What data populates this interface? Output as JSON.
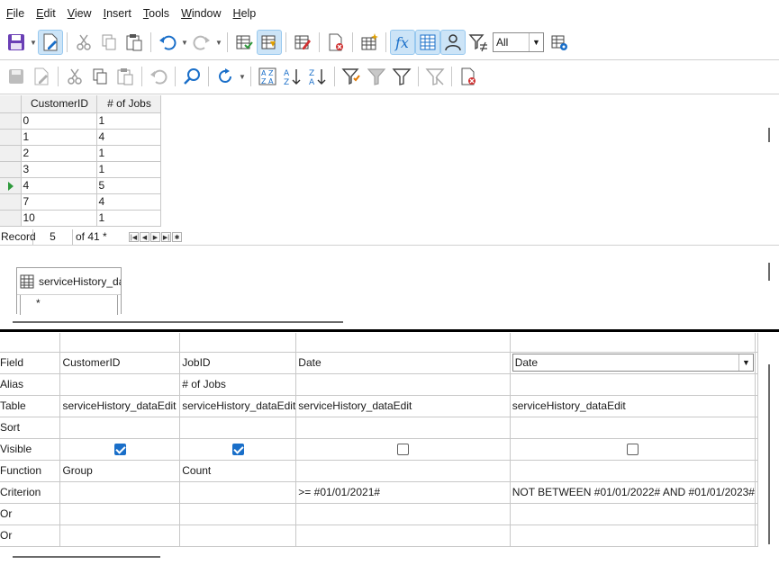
{
  "menu": [
    "File",
    "Edit",
    "View",
    "Insert",
    "Tools",
    "Window",
    "Help"
  ],
  "menu_mnemonics": [
    "F",
    "E",
    "V",
    "I",
    "T",
    "W",
    "H"
  ],
  "filter_select": {
    "value": "All"
  },
  "result": {
    "columns": [
      "CustomerID",
      "# of Jobs"
    ],
    "rows": [
      [
        "0",
        "1"
      ],
      [
        "1",
        "4"
      ],
      [
        "2",
        "1"
      ],
      [
        "3",
        "1"
      ],
      [
        "4",
        "5"
      ],
      [
        "7",
        "4"
      ],
      [
        "10",
        "1"
      ]
    ],
    "current_row_index": 4
  },
  "navigation": {
    "label": "Record",
    "current": "5",
    "of_text": "of 41 *"
  },
  "table_window": {
    "title": "serviceHistory_dataEdit",
    "field": "*"
  },
  "design": {
    "row_labels": [
      "Field",
      "Alias",
      "Table",
      "Sort",
      "Visible",
      "Function",
      "Criterion",
      "Or",
      "Or"
    ],
    "columns": [
      {
        "field": "CustomerID",
        "alias": "",
        "table": "serviceHistory_dataEdit",
        "sort": "",
        "visible": true,
        "function": "Group",
        "criterion": "",
        "or1": "",
        "or2": ""
      },
      {
        "field": "JobID",
        "alias": "# of Jobs",
        "table": "serviceHistory_dataEdit",
        "sort": "",
        "visible": true,
        "function": "Count",
        "criterion": "",
        "or1": "",
        "or2": ""
      },
      {
        "field": "Date",
        "alias": "",
        "table": "serviceHistory_dataEdit",
        "sort": "",
        "visible": false,
        "function": "",
        "criterion": ">= #01/01/2021#",
        "or1": "",
        "or2": ""
      },
      {
        "field": "Date",
        "alias": "",
        "table": "serviceHistory_dataEdit",
        "sort": "",
        "visible": false,
        "function": "",
        "criterion": "NOT BETWEEN #01/01/2022# AND #01/01/2023#",
        "or1": "",
        "or2": ""
      }
    ]
  },
  "colors": {
    "accent": "#1a6fc9",
    "active_button": "#cce4f7",
    "current_row": "#2e9a3c",
    "splitter": "#000000"
  },
  "toolbar1_icons": [
    "save-icon",
    "edit-mode-icon",
    "cut-icon",
    "copy-icon",
    "paste-icon",
    "undo-icon",
    "redo-icon",
    "run-query-icon",
    "clear-query-icon",
    "add-tables-icon",
    "functions-icon",
    "table-name-icon",
    "alias-icon",
    "distinct-values-icon",
    "limit-icon",
    "sql-mode-icon"
  ],
  "toolbar2_icons": [
    "save-record-icon",
    "edit-data-icon",
    "cut-icon",
    "copy-icon",
    "paste-icon",
    "undo-icon",
    "find-record-icon",
    "refresh-icon",
    "sort-icon",
    "sort-ascending-icon",
    "sort-descending-icon",
    "autofilter-icon",
    "apply-filter-icon",
    "standard-filter-icon",
    "reset-filter-icon",
    "delete-record-icon"
  ]
}
